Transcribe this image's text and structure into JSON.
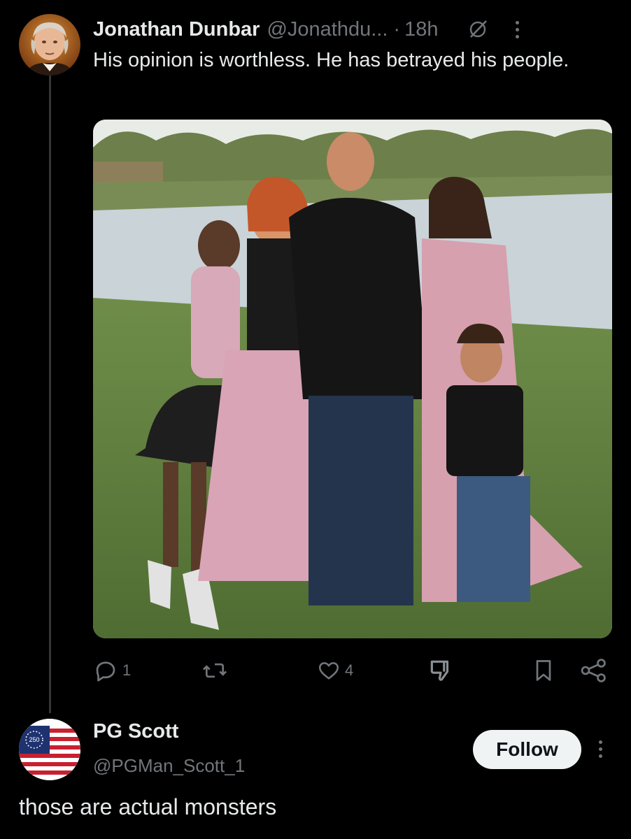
{
  "post": {
    "author_name": "Jonathan Dunbar",
    "author_handle": "@Jonathdu...",
    "separator": "·",
    "time": "18h",
    "text": "His opinion is worthless. He has betrayed his people.",
    "avatar_icon": "portrait-avatar-icon",
    "image_icon": "family-photo",
    "actions": {
      "replies": "1",
      "reposts": "",
      "likes": "4"
    }
  },
  "reply": {
    "author_name": "PG Scott",
    "author_handle": "@PGMan_Scott_1",
    "follow_label": "Follow",
    "text": "those are actual monsters",
    "avatar_icon": "betsy-ross-flag-avatar-icon",
    "avatar_badge": "250"
  },
  "colors": {
    "background": "#000000",
    "text_primary": "#e7e9ea",
    "text_secondary": "#71767b",
    "follow_bg": "#eff3f4"
  }
}
